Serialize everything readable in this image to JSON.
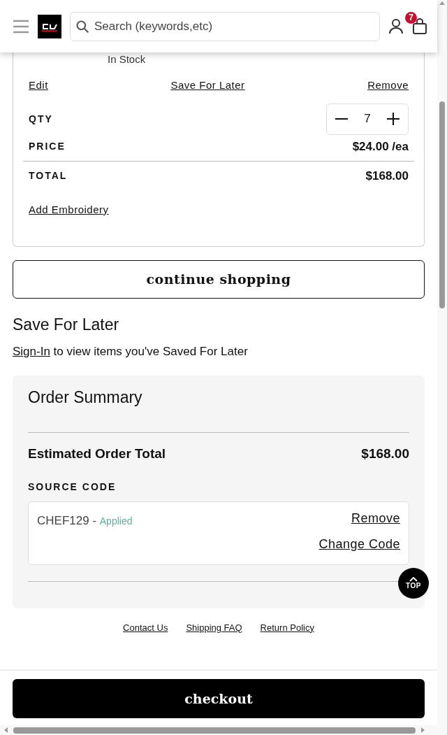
{
  "header": {
    "search": {
      "placeholder": "Search (keywords,etc)"
    },
    "cart_count": "7"
  },
  "cart_item": {
    "stock": "In Stock",
    "actions": [
      "Edit",
      "Save For Later",
      "Remove"
    ],
    "qty_label": "QTY",
    "qty": "7",
    "price_label": "PRICE",
    "price": "$24.00 /ea",
    "total_label": "TOTAL",
    "total": "$168.00",
    "embroidery_link": "Add Embroidery"
  },
  "continue_button": "continue shopping",
  "save_for_later": {
    "title": "Save For Later",
    "sign_in_link": "Sign-In",
    "message": "to view items you've Saved For Later"
  },
  "order_summary": {
    "title": "Order Summary",
    "estimated_label": "Estimated Order Total",
    "estimated_value": "$168.00",
    "source_code_label": "SOURCE CODE",
    "code": "CHEF129",
    "separator": "-",
    "status": "Applied",
    "remove_link": "Remove",
    "change_link": "Change Code"
  },
  "top_button": "TOP",
  "footer_links": [
    "Contact Us",
    "Shipping FAQ",
    "Return Policy"
  ],
  "checkout_button": "checkout"
}
